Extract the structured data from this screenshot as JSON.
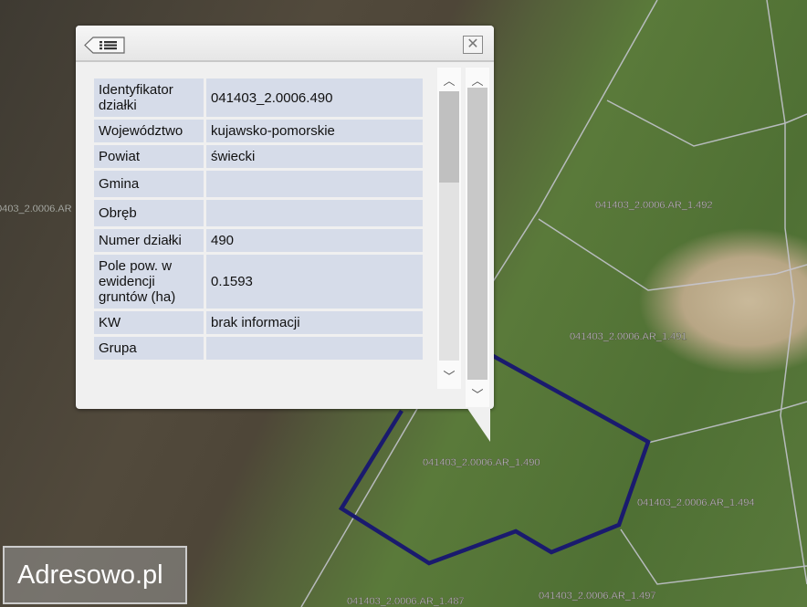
{
  "popup": {
    "back_icon": "list-back-icon",
    "close_icon": "close-icon",
    "rows": [
      {
        "label": "Identyfikator działki",
        "value": "041403_2.0006.490"
      },
      {
        "label": "Województwo",
        "value": "kujawsko-pomorskie"
      },
      {
        "label": "Powiat",
        "value": "świecki"
      },
      {
        "label": "Gmina",
        "value": ""
      },
      {
        "label": "Obręb",
        "value": ""
      },
      {
        "label": "Numer działki",
        "value": "490"
      },
      {
        "label": "Pole pow. w ewidencji gruntów (ha)",
        "value": "0.1593"
      },
      {
        "label": "KW",
        "value": "brak informacji"
      },
      {
        "label": "Grupa",
        "value": ""
      }
    ]
  },
  "map": {
    "parcel_labels": [
      "041403_2.0006.AR_1.492",
      "041403_2.0006.AR_1.491",
      "041403_2.0006.AR_1.490",
      "041403_2.0006.AR_1.494",
      "041403_2.0006.AR_1.497",
      "041403_2.0006.AR_1.487",
      "0403_2.0006.AR"
    ],
    "selected_outline_color": "#1a1a6e"
  },
  "logo": {
    "text": "Adresowo.pl"
  }
}
